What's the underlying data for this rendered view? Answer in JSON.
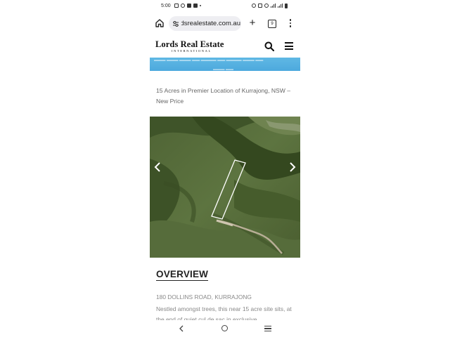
{
  "status_bar": {
    "time": "5:00"
  },
  "browser": {
    "url": "lordsrealestate.com.au",
    "tab_count": "9",
    "icons": [
      "home-icon",
      "tune-icon",
      "plus-icon",
      "tabs-icon",
      "more-vert-icon"
    ]
  },
  "site": {
    "logo_main": "Lords Real Estate",
    "logo_sub": "INTERNATIONAL",
    "icons": [
      "search-icon",
      "hamburger-menu-icon"
    ]
  },
  "banner": {
    "color": "#52aedf"
  },
  "listing": {
    "title": "15 Acres in Premier Location of Kurrajong, NSW – New Price",
    "section_heading": "OVERVIEW",
    "address": "180 DOLLINS ROAD, KURRAJONG",
    "description": "Nestled amongst trees, this near 15 acre site sits, at the end of quiet cul de sac in exclusive"
  },
  "gallery": {
    "prev_icon": "chevron-left-icon",
    "next_icon": "chevron-right-icon"
  },
  "nav": {
    "icons": [
      "back-icon",
      "home-circle-icon",
      "recents-icon"
    ]
  }
}
